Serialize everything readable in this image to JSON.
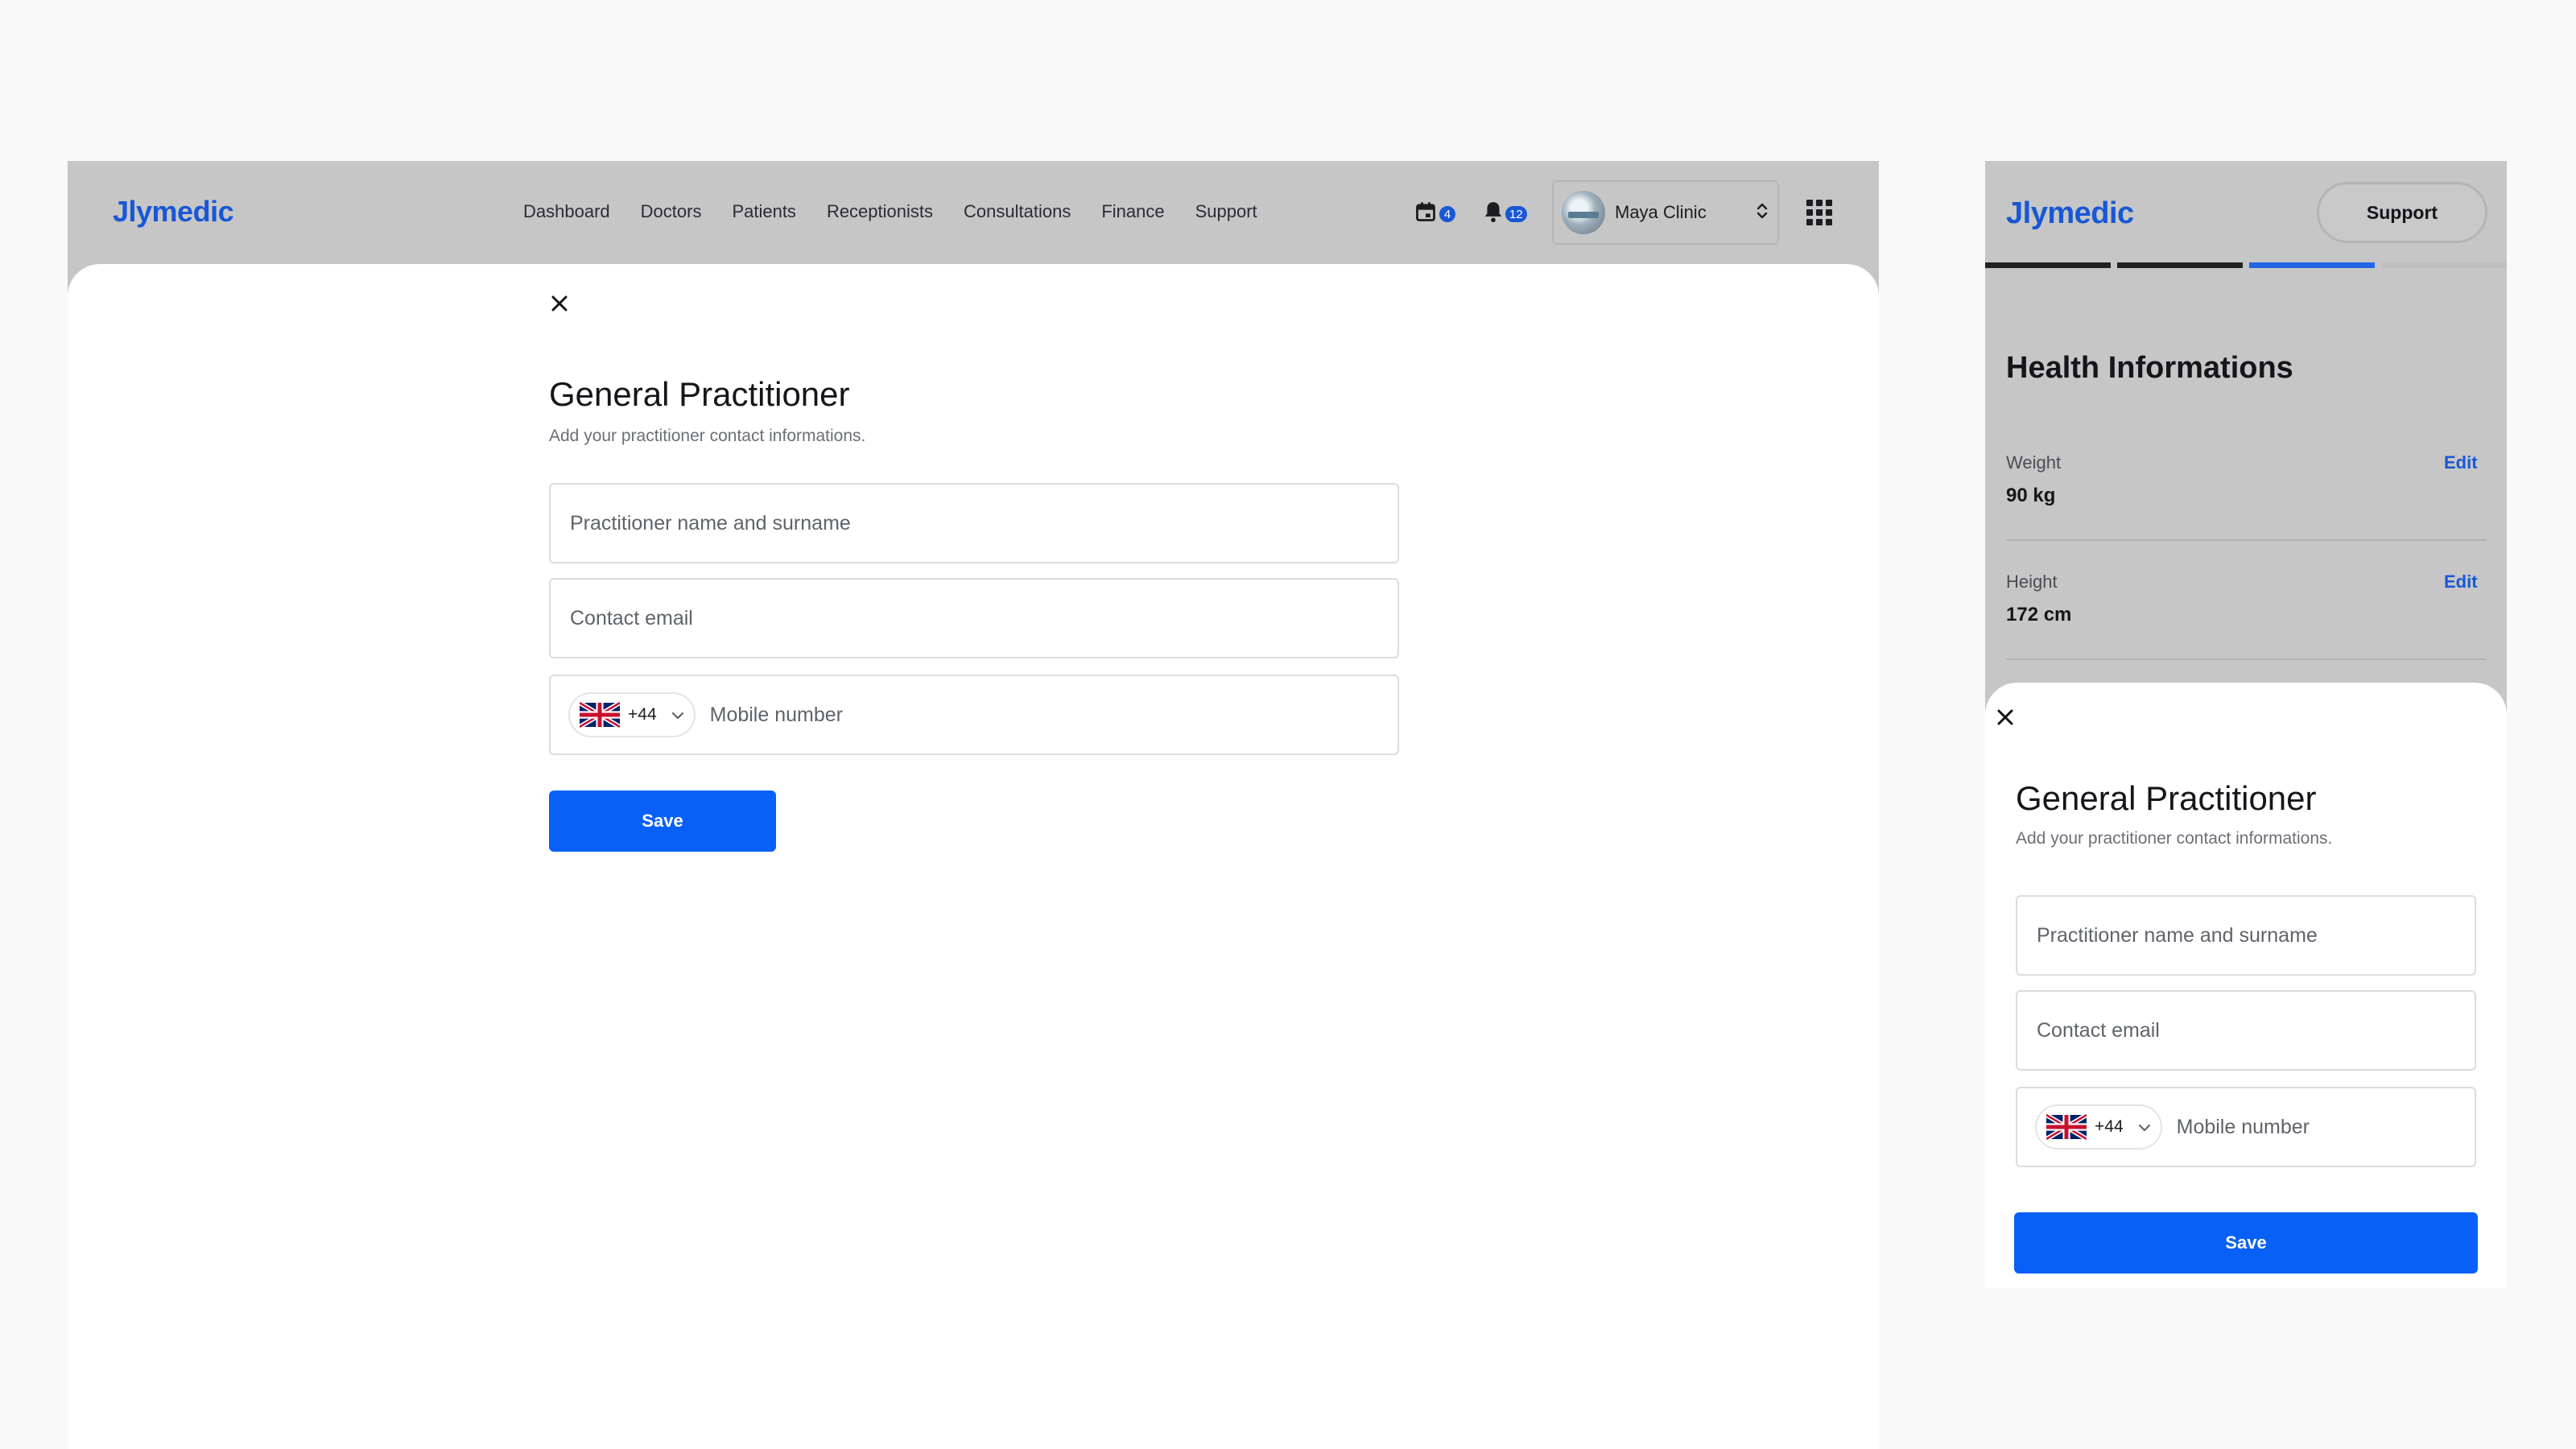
{
  "brand": {
    "name": "Jlymedic",
    "color": "#1857d6"
  },
  "colors": {
    "primary": "#0860f7",
    "overlay": "#c6c6c6",
    "sheet": "#ffffff"
  },
  "desktop": {
    "nav": [
      "Dashboard",
      "Doctors",
      "Patients",
      "Receptionists",
      "Consultations",
      "Finance",
      "Support"
    ],
    "calendar_badge": "4",
    "notification_badge": "12",
    "clinic_name": "Maya Clinic",
    "icons": [
      "calendar-icon",
      "bell-icon",
      "chevron-up-down-icon",
      "apps-grid-icon"
    ]
  },
  "mobile": {
    "support_label": "Support",
    "steps_total": 4,
    "step_active": 3,
    "section_title": "Health Informations",
    "info_rows": [
      {
        "label": "Weight",
        "value": "90 kg",
        "action": "Edit"
      },
      {
        "label": "Height",
        "value": "172 cm",
        "action": "Edit"
      }
    ]
  },
  "form": {
    "title": "General Practitioner",
    "subtitle": "Add your practitioner contact informations.",
    "name_placeholder": "Practitioner name and surname",
    "email_placeholder": "Contact email",
    "country_code": "+44",
    "country_flag": "uk-flag-icon",
    "phone_placeholder": "Mobile number",
    "save_label": "Save",
    "close_icon": "close-icon"
  }
}
